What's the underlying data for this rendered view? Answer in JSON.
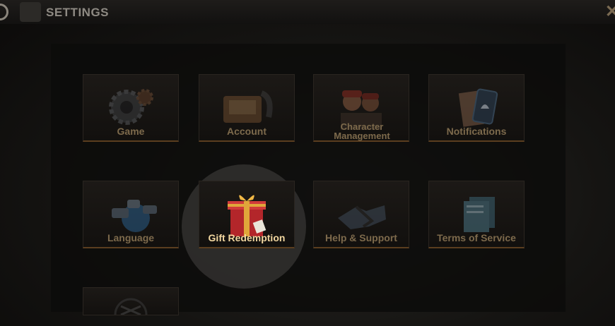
{
  "header": {
    "title": "SETTINGS"
  },
  "tiles": [
    {
      "label": "Game"
    },
    {
      "label": "Account"
    },
    {
      "label": "Character Management"
    },
    {
      "label": "Notifications"
    },
    {
      "label": "Language"
    },
    {
      "label": "Gift Redemption"
    },
    {
      "label": "Help & Support"
    },
    {
      "label": "Terms of Service"
    },
    {
      "label": ""
    }
  ]
}
